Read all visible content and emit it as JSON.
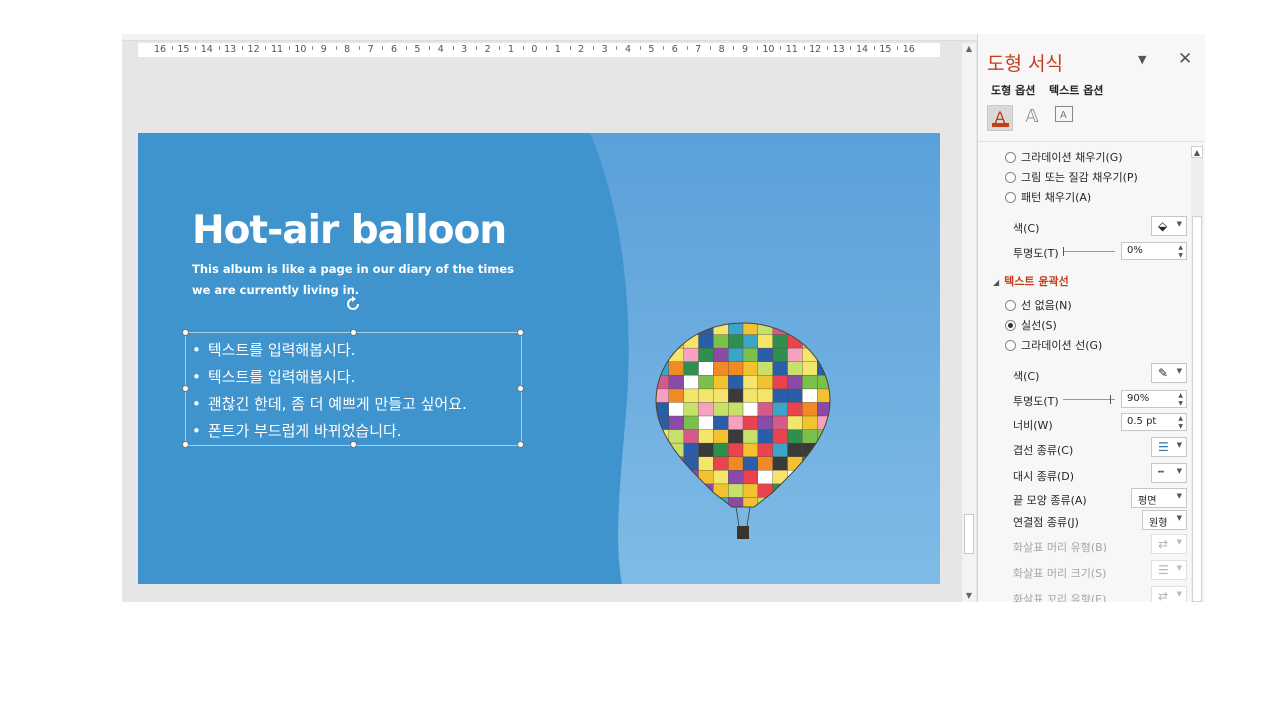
{
  "ruler": {
    "labels": [
      "16",
      "15",
      "14",
      "13",
      "12",
      "11",
      "10",
      "9",
      "8",
      "7",
      "6",
      "5",
      "4",
      "3",
      "2",
      "1",
      "0",
      "1",
      "2",
      "3",
      "4",
      "5",
      "6",
      "7",
      "8",
      "9",
      "10",
      "11",
      "12",
      "13",
      "14",
      "15",
      "16"
    ]
  },
  "slide": {
    "title": "Hot-air balloon",
    "subtitle": "This album is like a page in our diary of the times we are currently living in.",
    "bullets": [
      "텍스트를 입력해봅시다.",
      "텍스트를 입력해봅시다.",
      "괜찮긴 한데, 좀 더 예쁘게 만들고 싶어요.",
      "폰트가 부드럽게 바뀌었습니다."
    ],
    "colors": {
      "left_panel": "#3f94cd",
      "sky_top": "#5aa0da",
      "sky_bottom": "#7fbbe6",
      "title": "#ffffff"
    }
  },
  "pane": {
    "title": "도형 서식",
    "tabs": {
      "shape": "도형 옵션",
      "text": "텍스트 옵션"
    },
    "icons": [
      "text-fill-outline-icon",
      "text-effects-icon",
      "textbox-icon"
    ],
    "fill": {
      "gradient_fill": "그라데이션 채우기(G)",
      "picture_fill": "그림 또는 질감 채우기(P)",
      "pattern_fill": "패턴 채우기(A)",
      "color_label": "색(C)",
      "transparency_label": "투명도(T)",
      "transparency_value": "0%",
      "transparency": 0
    },
    "outline": {
      "heading": "텍스트 윤곽선",
      "no_line": "선 없음(N)",
      "solid_line": "실선(S)",
      "gradient_line": "그라데이션 선(G)",
      "selected": "solid_line",
      "color_label": "색(C)",
      "transparency_label": "투명도(T)",
      "transparency_value": "90%",
      "transparency": 0.9,
      "width_label": "너비(W)",
      "width_value": "0.5 pt",
      "compound_label": "겹선 종류(C)",
      "dash_label": "대시 종류(D)",
      "cap_label": "끝 모양 종류(A)",
      "cap_value": "평면",
      "join_label": "연결점 종류(J)",
      "join_value": "원형",
      "arrow_begin_type": "화살표 머리 유형(B)",
      "arrow_begin_size": "화살표 머리 크기(S)",
      "arrow_end_type": "화살표 꼬리 유형(E)"
    },
    "accent": "#c43e1c"
  }
}
